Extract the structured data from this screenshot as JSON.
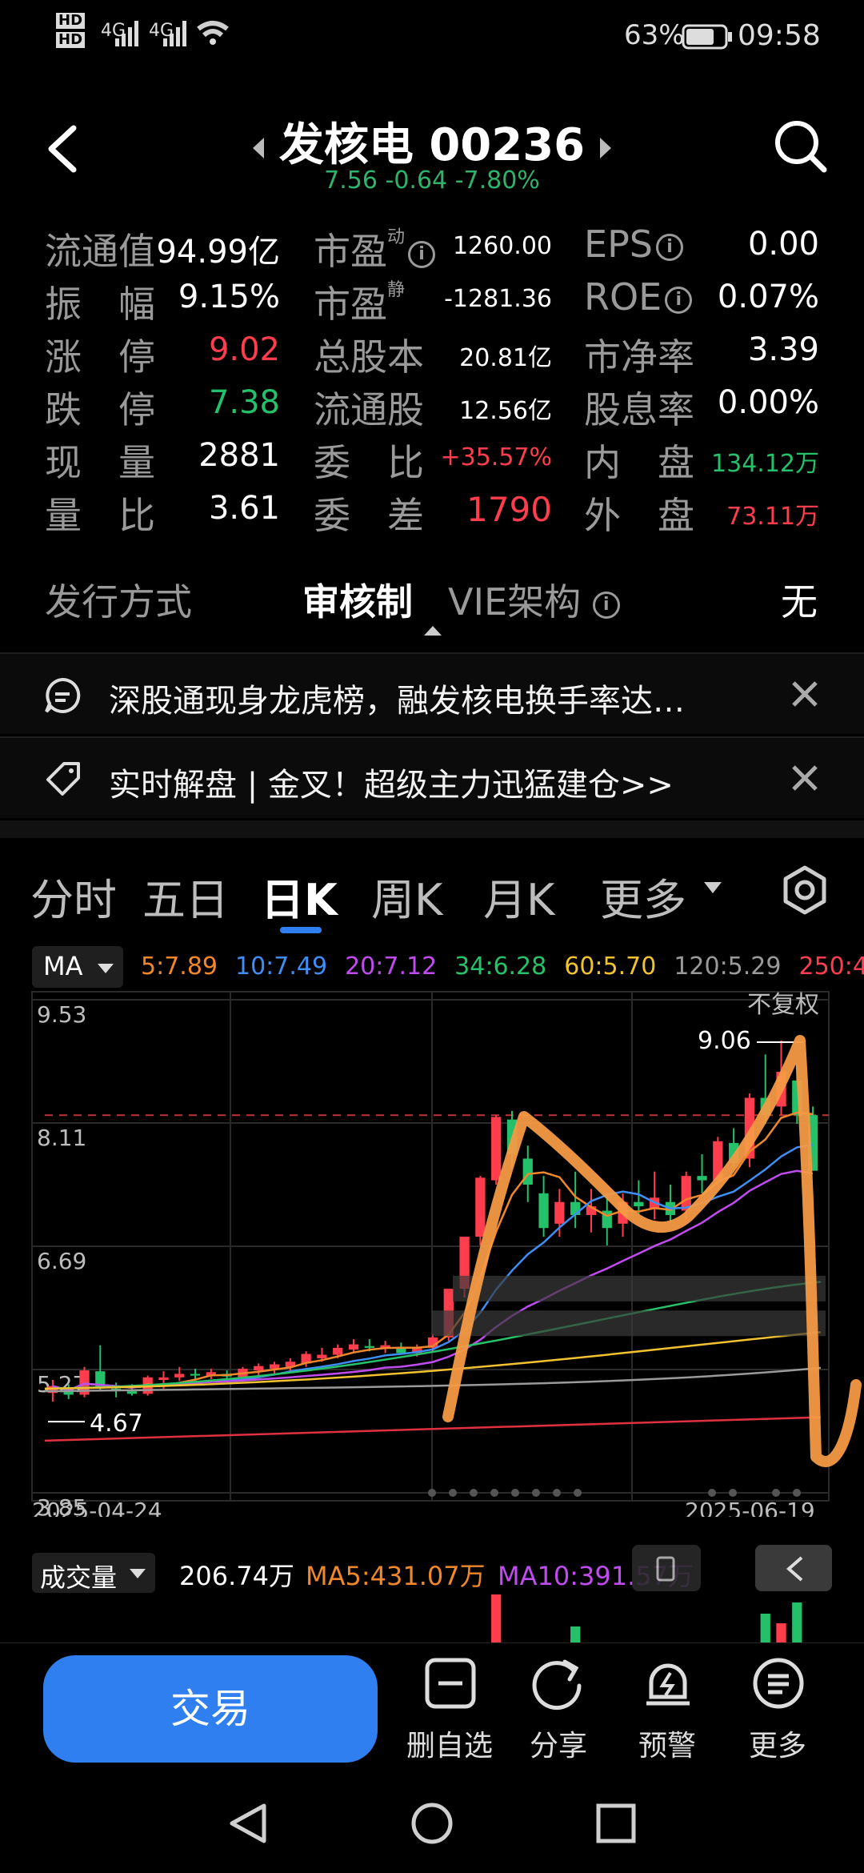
{
  "status_bar": {
    "sim1": "HD",
    "sim2": "HD",
    "net1": "4G",
    "net2": "4G",
    "battery": "63%",
    "time": "09:58"
  },
  "header": {
    "title": "发核电 00236",
    "price": "7.56",
    "change": "-0.64",
    "change_pct": "-7.80%"
  },
  "stats": {
    "rows": [
      [
        {
          "label": "流通值",
          "value": "94.99亿",
          "c": ""
        },
        {
          "label": "市盈",
          "sup": "动",
          "info": true,
          "value": "1260.00",
          "c": ""
        },
        {
          "label": "EPS",
          "info": true,
          "value": "0.00",
          "c": ""
        }
      ],
      [
        {
          "label": "振　幅",
          "value": "9.15%",
          "c": ""
        },
        {
          "label": "市盈",
          "sup": "静",
          "value": "-1281.36",
          "c": ""
        },
        {
          "label": "ROE",
          "info": true,
          "value": "0.07%",
          "c": ""
        }
      ],
      [
        {
          "label": "涨　停",
          "value": "9.02",
          "c": "red"
        },
        {
          "label": "总股本",
          "value": "20.81亿",
          "c": ""
        },
        {
          "label": "市净率",
          "value": "3.39",
          "c": ""
        }
      ],
      [
        {
          "label": "跌　停",
          "value": "7.38",
          "c": "green"
        },
        {
          "label": "流通股",
          "value": "12.56亿",
          "c": ""
        },
        {
          "label": "股息率",
          "value": "0.00%",
          "c": ""
        }
      ],
      [
        {
          "label": "现　量",
          "value": "2881",
          "c": ""
        },
        {
          "label": "委　比",
          "value": "+35.57%",
          "c": "red"
        },
        {
          "label": "内　盘",
          "value": "134.12万",
          "c": "green"
        }
      ],
      [
        {
          "label": "量　比",
          "value": "3.61",
          "c": ""
        },
        {
          "label": "委　差",
          "value": "1790",
          "c": "red"
        },
        {
          "label": "外　盘",
          "value": "73.11万",
          "c": "red"
        }
      ]
    ],
    "issue_label": "发行方式",
    "issue_value": "审核制",
    "vie_label": "VIE架构",
    "vie_value": "无"
  },
  "news": [
    {
      "text": "深股通现身龙虎榜，融发核电换手率达…"
    },
    {
      "text": "实时解盘 | 金叉！超级主力迅猛建仓>>"
    }
  ],
  "tabs": [
    "分时",
    "五日",
    "日K",
    "周K",
    "月K",
    "更多"
  ],
  "active_tab": 2,
  "ma_bar": {
    "selector": "MA",
    "items": [
      {
        "label": "5:7.89",
        "color": "#f0882b"
      },
      {
        "label": "10:7.49",
        "color": "#3f8ef5"
      },
      {
        "label": "20:7.12",
        "color": "#c04cf0"
      },
      {
        "label": "34:6.28",
        "color": "#26c26a"
      },
      {
        "label": "60:5.70",
        "color": "#f2c230"
      },
      {
        "label": "120:5.29",
        "color": "#9a9a9a"
      },
      {
        "label": "250:4",
        "color": "#ff3d4d"
      }
    ]
  },
  "chart": {
    "y_labels": [
      "9.53",
      "8.11",
      "6.69",
      "5.27",
      "3.85"
    ],
    "high_label": "9.06",
    "low_label": "4.67",
    "adjust_label": "不复权",
    "start_date": "2025-04-24",
    "end_date": "2025-06-19"
  },
  "chart_data": {
    "type": "candlestick",
    "x_range": [
      "2025-04-24",
      "2025-06-19"
    ],
    "ylim": [
      3.85,
      9.53
    ],
    "high": 9.06,
    "low": 4.67,
    "ohlc": [
      [
        5.0,
        5.15,
        4.9,
        5.08
      ],
      [
        5.05,
        5.1,
        4.93,
        4.98
      ],
      [
        4.98,
        5.3,
        4.95,
        5.26
      ],
      [
        5.25,
        5.55,
        5.02,
        5.05
      ],
      [
        5.05,
        5.12,
        4.95,
        5.02
      ],
      [
        5.02,
        5.1,
        4.97,
        4.99
      ],
      [
        4.99,
        5.2,
        4.97,
        5.18
      ],
      [
        5.15,
        5.25,
        5.05,
        5.18
      ],
      [
        5.18,
        5.3,
        5.14,
        5.22
      ],
      [
        5.22,
        5.28,
        5.15,
        5.2
      ],
      [
        5.2,
        5.28,
        5.16,
        5.24
      ],
      [
        5.22,
        5.26,
        5.16,
        5.19
      ],
      [
        5.18,
        5.3,
        5.16,
        5.28
      ],
      [
        5.26,
        5.34,
        5.2,
        5.31
      ],
      [
        5.28,
        5.36,
        5.22,
        5.33
      ],
      [
        5.3,
        5.4,
        5.25,
        5.36
      ],
      [
        5.34,
        5.48,
        5.3,
        5.45
      ],
      [
        5.4,
        5.52,
        5.36,
        5.44
      ],
      [
        5.44,
        5.56,
        5.4,
        5.52
      ],
      [
        5.5,
        5.62,
        5.46,
        5.56
      ],
      [
        5.54,
        5.62,
        5.48,
        5.52
      ],
      [
        5.52,
        5.6,
        5.46,
        5.55
      ],
      [
        5.52,
        5.58,
        5.44,
        5.46
      ],
      [
        5.46,
        5.56,
        5.42,
        5.52
      ],
      [
        5.52,
        5.68,
        5.48,
        5.64
      ],
      [
        5.64,
        6.2,
        5.6,
        6.2
      ],
      [
        6.2,
        6.8,
        6.1,
        6.8
      ],
      [
        6.8,
        7.5,
        6.7,
        7.48
      ],
      [
        7.45,
        8.2,
        7.4,
        8.18
      ],
      [
        8.15,
        8.25,
        7.6,
        7.75
      ],
      [
        7.7,
        7.85,
        7.2,
        7.4
      ],
      [
        7.3,
        7.5,
        6.8,
        6.9
      ],
      [
        6.95,
        7.35,
        6.8,
        7.2
      ],
      [
        7.2,
        7.55,
        6.9,
        7.05
      ],
      [
        7.05,
        7.35,
        6.85,
        7.15
      ],
      [
        7.1,
        7.28,
        6.7,
        6.9
      ],
      [
        6.95,
        7.3,
        6.8,
        7.2
      ],
      [
        7.2,
        7.45,
        7.05,
        7.15
      ],
      [
        7.12,
        7.55,
        7.0,
        7.25
      ],
      [
        7.2,
        7.4,
        6.95,
        7.05
      ],
      [
        7.1,
        7.55,
        7.0,
        7.5
      ],
      [
        7.5,
        7.75,
        7.3,
        7.45
      ],
      [
        7.45,
        7.95,
        7.4,
        7.9
      ],
      [
        7.88,
        8.05,
        7.6,
        7.65
      ],
      [
        7.7,
        8.45,
        7.6,
        8.4
      ],
      [
        8.4,
        8.9,
        8.1,
        8.2
      ],
      [
        8.3,
        9.06,
        8.2,
        8.7
      ],
      [
        8.6,
        8.8,
        8.1,
        8.2
      ],
      [
        8.2,
        8.3,
        7.56,
        7.56
      ]
    ],
    "ma": {
      "5": 7.89,
      "10": 7.49,
      "20": 7.12,
      "34": 6.28,
      "60": 5.7,
      "120": 5.29
    }
  },
  "volume": {
    "selector": "成交量",
    "value": "206.74万",
    "ma5": "MA5:431.07万",
    "ma10": "MA10:391.57万"
  },
  "bottom_bar": {
    "trade": "交易",
    "items": [
      "删自选",
      "分享",
      "预警",
      "更多"
    ]
  }
}
